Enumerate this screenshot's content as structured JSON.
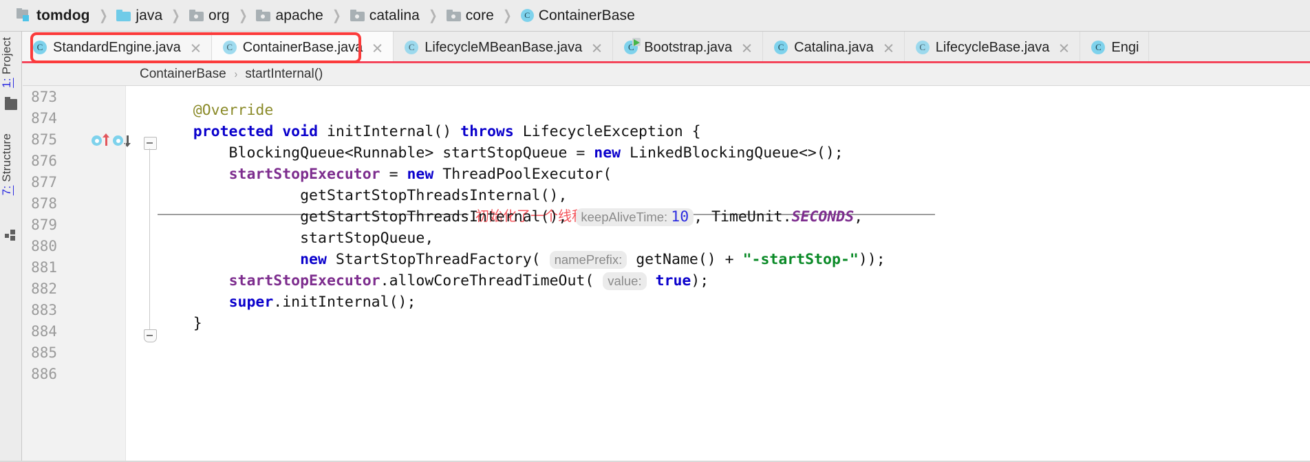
{
  "breadcrumb": {
    "items": [
      {
        "label": "tomdog",
        "icon": "module-icon",
        "bold": true
      },
      {
        "label": "java",
        "icon": "folder-blue-icon",
        "bold": false
      },
      {
        "label": "org",
        "icon": "folder-package-icon",
        "bold": false
      },
      {
        "label": "apache",
        "icon": "folder-package-icon",
        "bold": false
      },
      {
        "label": "catalina",
        "icon": "folder-package-icon",
        "bold": false
      },
      {
        "label": "core",
        "icon": "folder-package-icon",
        "bold": false
      },
      {
        "label": "ContainerBase",
        "icon": "java-class-icon",
        "bold": false
      }
    ],
    "separator": "❯"
  },
  "tabs": [
    {
      "label": "StandardEngine.java",
      "icon": "java-class-icon",
      "state": "selected",
      "closable": true,
      "running": false
    },
    {
      "label": "ContainerBase.java",
      "icon": "java-class-icon-faded",
      "state": "active",
      "closable": true,
      "running": false
    },
    {
      "label": "LifecycleMBeanBase.java",
      "icon": "java-class-icon-faded",
      "state": "normal",
      "closable": true,
      "running": false
    },
    {
      "label": "Bootstrap.java",
      "icon": "java-class-icon",
      "state": "normal",
      "closable": false,
      "running": true
    },
    {
      "label": "Catalina.java",
      "icon": "java-class-icon",
      "state": "normal",
      "closable": true,
      "running": false
    },
    {
      "label": "LifecycleBase.java",
      "icon": "java-class-icon-faded",
      "state": "normal",
      "closable": true,
      "running": false
    },
    {
      "label": "Engi",
      "icon": "java-class-icon",
      "state": "normal",
      "closable": false,
      "running": false
    }
  ],
  "sidebar": {
    "items": [
      {
        "label_num": "1:",
        "label": " Project",
        "icon": "project-folder-icon"
      },
      {
        "label_num": "7:",
        "label": " Structure",
        "icon": "structure-icon"
      }
    ]
  },
  "member_breadcrumb": {
    "class": "ContainerBase",
    "separator": "›",
    "member": "startInternal()"
  },
  "annotation": {
    "text": "初始化了一个线程池和阻塞队列",
    "color": "#f4565d",
    "tab_highlight_color": "#fb3b3b"
  },
  "editor": {
    "line_numbers": [
      "873",
      "874",
      "875",
      "876",
      "877",
      "878",
      "879",
      "880",
      "881",
      "882",
      "883",
      "884",
      "885",
      "886"
    ],
    "gutter_markers": {
      "line": "875",
      "implementing_up": "implementing-method-up-icon",
      "implementing_down": "overriding-method-down-icon"
    },
    "code_lines": [
      {
        "n": "873",
        "segments": []
      },
      {
        "n": "874",
        "segments": [
          {
            "t": "    ",
            "c": "pln"
          },
          {
            "t": "@Override",
            "c": "ann"
          }
        ]
      },
      {
        "n": "875",
        "segments": [
          {
            "t": "    ",
            "c": "pln"
          },
          {
            "t": "protected",
            "c": "k"
          },
          {
            "t": " ",
            "c": "pln"
          },
          {
            "t": "void",
            "c": "k"
          },
          {
            "t": " initInternal() ",
            "c": "pln"
          },
          {
            "t": "throws",
            "c": "k"
          },
          {
            "t": " LifecycleException {",
            "c": "pln"
          }
        ]
      },
      {
        "n": "876",
        "segments": [
          {
            "t": "        BlockingQueue<Runnable> startStopQueue = ",
            "c": "pln"
          },
          {
            "t": "new",
            "c": "k"
          },
          {
            "t": " LinkedBlockingQueue<>();",
            "c": "pln"
          }
        ]
      },
      {
        "n": "877",
        "segments": [
          {
            "t": "        ",
            "c": "pln"
          },
          {
            "t": "startStopExecutor",
            "c": "fld"
          },
          {
            "t": " = ",
            "c": "pln"
          },
          {
            "t": "new",
            "c": "k"
          },
          {
            "t": " ThreadPoolExecutor(",
            "c": "pln"
          }
        ]
      },
      {
        "n": "878",
        "segments": [
          {
            "t": "                getStartStopThreadsInternal(),",
            "c": "pln"
          }
        ]
      },
      {
        "n": "879",
        "segments": [
          {
            "t": "                getStartStopThreadsInternal(), ",
            "c": "pln"
          },
          {
            "t": "keepAliveTime:",
            "c": "hint",
            "value": "10"
          },
          {
            "t": ", TimeUnit.",
            "c": "pln"
          },
          {
            "t": "SECONDS",
            "c": "konst"
          },
          {
            "t": ",",
            "c": "pln"
          }
        ]
      },
      {
        "n": "880",
        "segments": [
          {
            "t": "                startStopQueue,",
            "c": "pln"
          }
        ]
      },
      {
        "n": "881",
        "segments": [
          {
            "t": "                ",
            "c": "pln"
          },
          {
            "t": "new",
            "c": "k"
          },
          {
            "t": " StartStopThreadFactory( ",
            "c": "pln"
          },
          {
            "t": "namePrefix:",
            "c": "hint2"
          },
          {
            "t": " getName() + ",
            "c": "pln"
          },
          {
            "t": "\"-startStop-\"",
            "c": "str"
          },
          {
            "t": "));",
            "c": "pln"
          }
        ]
      },
      {
        "n": "882",
        "segments": [
          {
            "t": "        ",
            "c": "pln"
          },
          {
            "t": "startStopExecutor",
            "c": "fld"
          },
          {
            "t": ".allowCoreThreadTimeOut( ",
            "c": "pln"
          },
          {
            "t": "value:",
            "c": "hint3"
          },
          {
            "t": "true",
            "c": "k"
          },
          {
            "t": ");",
            "c": "pln"
          }
        ]
      },
      {
        "n": "883",
        "segments": [
          {
            "t": "        ",
            "c": "pln"
          },
          {
            "t": "super",
            "c": "k"
          },
          {
            "t": ".initInternal();",
            "c": "pln"
          }
        ]
      },
      {
        "n": "884",
        "segments": [
          {
            "t": "    }",
            "c": "pln"
          }
        ]
      },
      {
        "n": "885",
        "segments": []
      },
      {
        "n": "886",
        "segments": []
      }
    ],
    "inlay_hints": [
      {
        "line": "879",
        "name": "keepAliveTime:",
        "value": "10"
      },
      {
        "line": "881",
        "name": "namePrefix:"
      },
      {
        "line": "882",
        "name": "value:"
      }
    ],
    "string_literal": "\"-startStop-\"",
    "constant": "SECONDS"
  },
  "colors": {
    "keyword": "#0a00cc",
    "annotation_kw": "#8a8a28",
    "field": "#7d2d8e",
    "string": "#0a8a27",
    "number": "#2a2ae0",
    "hint_bg": "#ebebeb",
    "tab_active_underline": "#4a7ebb",
    "note_red": "#f4565d"
  }
}
